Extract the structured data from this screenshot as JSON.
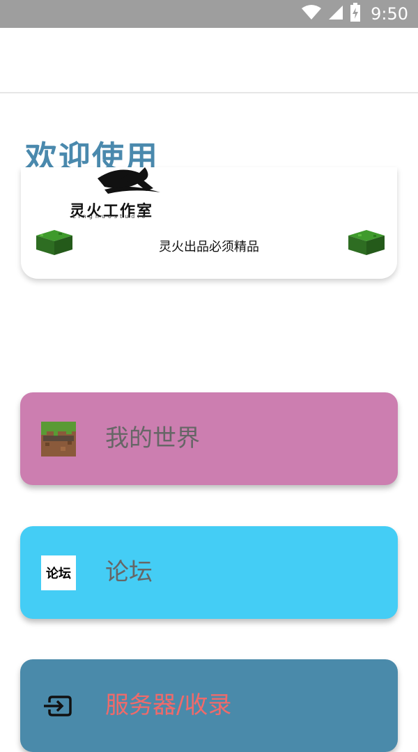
{
  "status_bar": {
    "time": "9:50",
    "icons": [
      "wifi-icon",
      "signal-icon",
      "battery-charging-icon"
    ]
  },
  "header": {
    "welcome": "欢迎使用"
  },
  "banner": {
    "studio_name": "灵火工作室",
    "studio_sub": "Linghuostudio",
    "slogan": "灵火出品必须精品",
    "icons": [
      "grass-block-icon",
      "grass-block-icon"
    ]
  },
  "menu": [
    {
      "label": "我的世界",
      "icon": "minecraft-icon",
      "bg": "#cc7eb0",
      "text_color": "#666666"
    },
    {
      "label": "论坛",
      "icon_text": "论坛",
      "icon": "forum-icon",
      "bg": "#44cdf5",
      "text_color": "#666666"
    },
    {
      "label": "服务器/收录",
      "icon": "exit-icon",
      "bg": "#4a8aaa",
      "text_color": "#f06a6a"
    }
  ]
}
